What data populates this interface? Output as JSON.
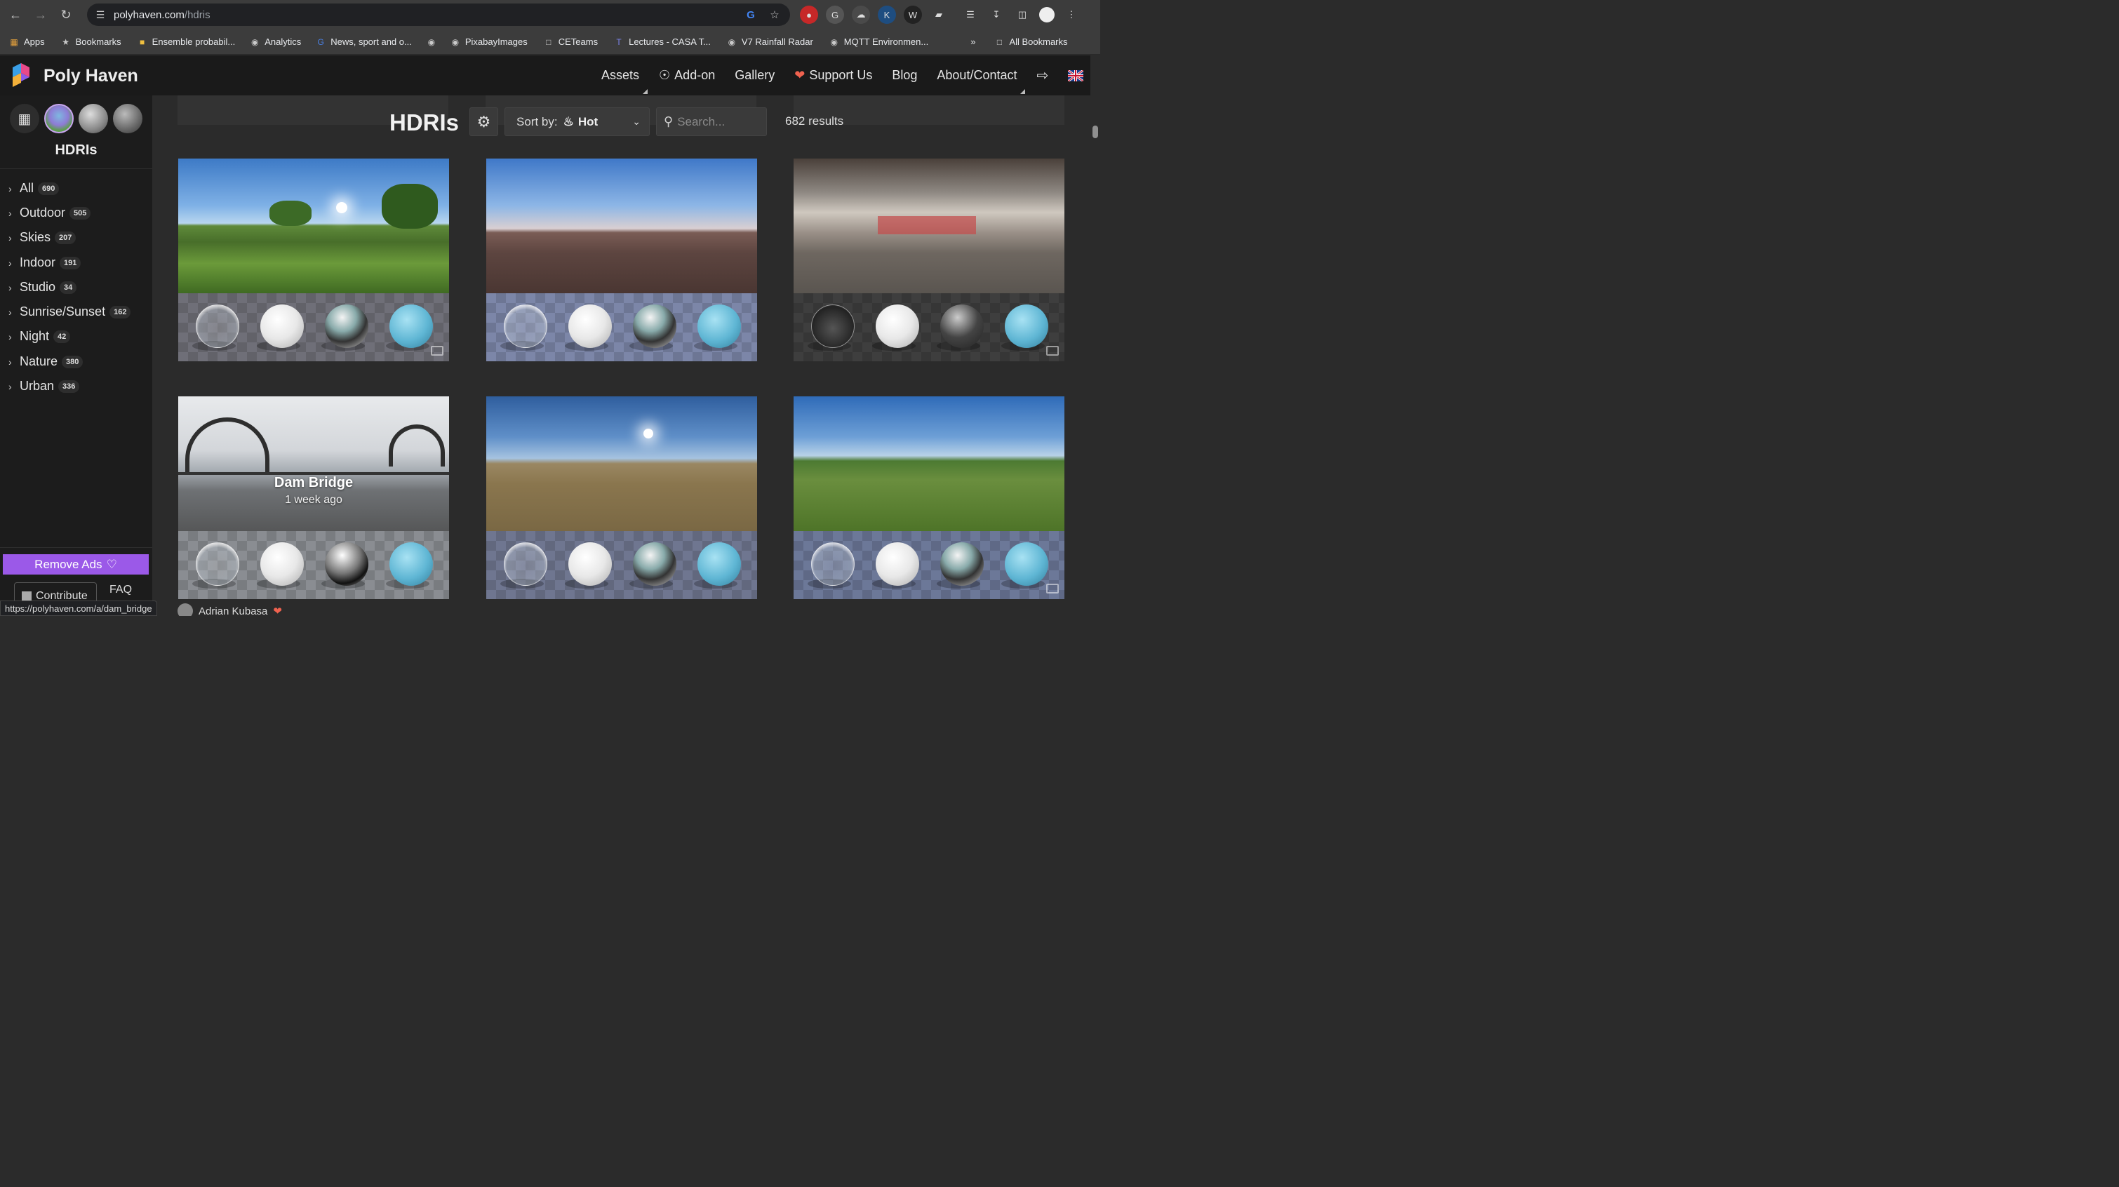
{
  "browser": {
    "url_host": "polyhaven.com",
    "url_path": "/hdris",
    "bookmarks": [
      {
        "label": "Apps",
        "icon": "apps-grid-icon"
      },
      {
        "label": "Bookmarks",
        "icon": "star-icon"
      },
      {
        "label": "Ensemble probabil...",
        "icon": "site-icon"
      },
      {
        "label": "Analytics",
        "icon": "globe-icon"
      },
      {
        "label": "News, sport and o...",
        "icon": "site-icon"
      },
      {
        "label": "",
        "icon": "globe-icon"
      },
      {
        "label": "PixabayImages",
        "icon": "globe-icon"
      },
      {
        "label": "CETeams",
        "icon": "folder-icon"
      },
      {
        "label": "Lectures - CASA T...",
        "icon": "teams-icon"
      },
      {
        "label": "V7 Rainfall Radar",
        "icon": "globe-icon"
      },
      {
        "label": "MQTT Environmen...",
        "icon": "globe-icon"
      }
    ],
    "bookmarks_overflow": "»",
    "all_bookmarks": "All Bookmarks",
    "status_url": "https://polyhaven.com/a/dam_bridge"
  },
  "site": {
    "brand": "Poly Haven",
    "nav": [
      {
        "label": "Assets",
        "icon": ""
      },
      {
        "label": "Add-on",
        "icon": "blender-icon"
      },
      {
        "label": "Gallery",
        "icon": ""
      },
      {
        "label": "Support Us",
        "icon": "heart-icon"
      },
      {
        "label": "Blog",
        "icon": ""
      },
      {
        "label": "About/Contact",
        "icon": ""
      }
    ],
    "accent": "#9b59e8",
    "heart_color": "#f0624f"
  },
  "sidebar": {
    "title": "HDRIs",
    "categories": [
      {
        "label": "All",
        "count": "690"
      },
      {
        "label": "Outdoor",
        "count": "505"
      },
      {
        "label": "Skies",
        "count": "207"
      },
      {
        "label": "Indoor",
        "count": "191"
      },
      {
        "label": "Studio",
        "count": "34"
      },
      {
        "label": "Sunrise/Sunset",
        "count": "162"
      },
      {
        "label": "Night",
        "count": "42"
      },
      {
        "label": "Nature",
        "count": "380"
      },
      {
        "label": "Urban",
        "count": "336"
      }
    ],
    "remove_ads": "Remove Ads",
    "contribute": "Contribute",
    "faq": "FAQ"
  },
  "main": {
    "heading": "HDRIs",
    "sort_label": "Sort by:",
    "sort_value": "Hot",
    "search_placeholder": "Search...",
    "results": "682 results",
    "cards": [
      {
        "title": "",
        "subtitle": ""
      },
      {
        "title": "",
        "subtitle": ""
      },
      {
        "title": "",
        "subtitle": ""
      },
      {
        "title": "Dam Bridge",
        "subtitle": "1 week ago"
      },
      {
        "title": "",
        "subtitle": ""
      },
      {
        "title": "",
        "subtitle": ""
      }
    ],
    "author": "Adrian Kubasa"
  }
}
